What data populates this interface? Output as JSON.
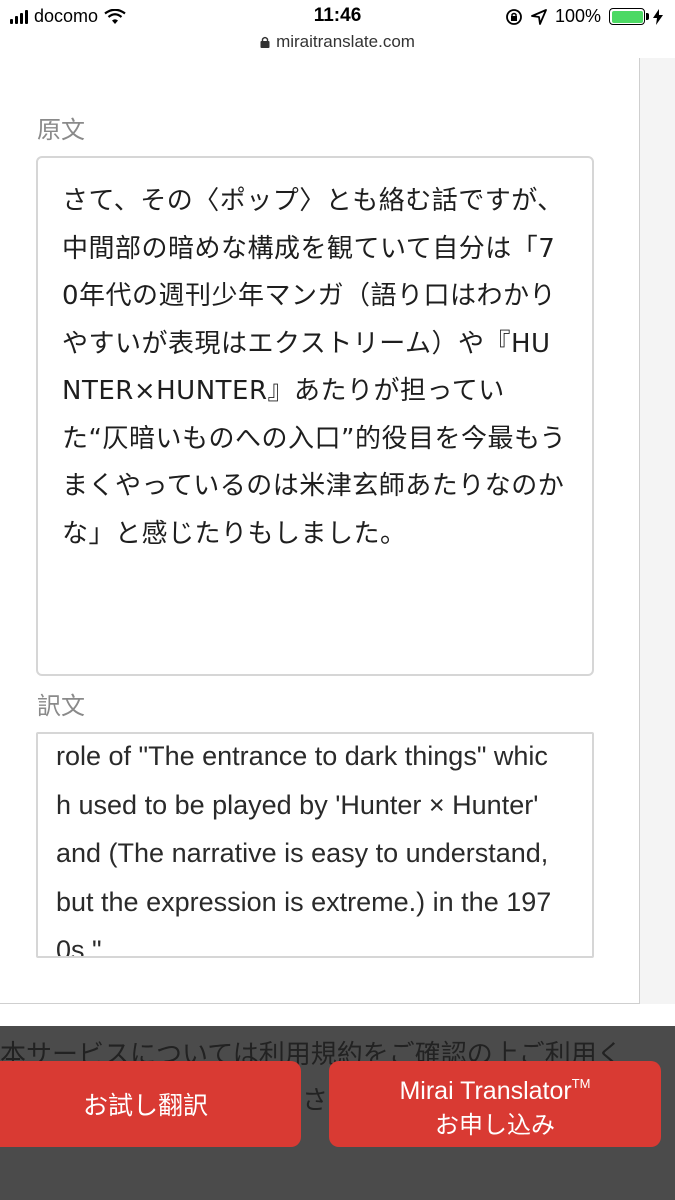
{
  "status_bar": {
    "carrier": "docomo",
    "time": "11:46",
    "battery_percent": "100%",
    "battery_level": 1.0,
    "battery_color": "#4cd964"
  },
  "browser": {
    "url": "miraitranslate.com"
  },
  "translator": {
    "source_label": "原文",
    "source_text": "さて、その〈ポップ〉とも絡む話ですが、中間部の暗めな構成を観ていて自分は「70年代の週刊少年マンガ（語り口はわかりやすいが表現はエクストリーム）や『HUNTER×HUNTER』あたりが担っていた“仄暗いものへの入口”的役目を今最もうまくやっているのは米津玄師あたりなのかな」と感じたりもしました。",
    "target_label": "訳文",
    "target_text": "role of \"The entrance to dark things\" whic\nh used to be played by 'Hunter × Hunter'\nand (The narrative is easy to understand,\nbut the expression is extreme.) in the 197\n0s.\"."
  },
  "footer": {
    "notice_text": "本サービスについては利用規約をご確認の上ご利用く",
    "notice_text_2": "さい",
    "trial_button": "お試し翻訳",
    "apply_button_line1": "Mirai Translator",
    "apply_button_tm": "TM",
    "apply_button_line2": "お申し込み"
  },
  "colors": {
    "button_red": "#d93a33",
    "overlay_gray": "#4b4b4b"
  }
}
